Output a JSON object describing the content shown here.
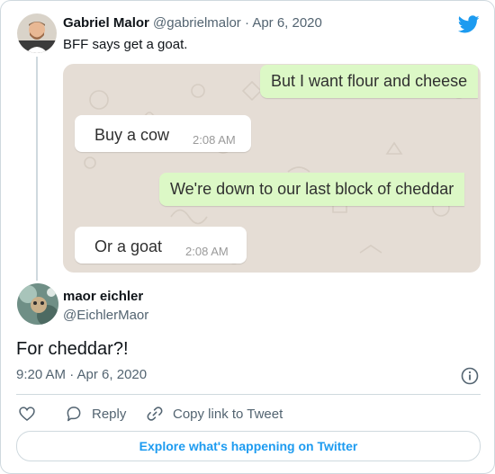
{
  "parent_tweet": {
    "author_name": "Gabriel Malor",
    "handle": "@gabrielmalor",
    "separator": "·",
    "date": "Apr 6, 2020",
    "text": "BFF says get a goat."
  },
  "chat_screenshot": {
    "messages": [
      {
        "text": "But I want flour and cheese",
        "direction": "outgoing"
      },
      {
        "text": "Buy a cow",
        "time": "2:08 AM",
        "direction": "incoming"
      },
      {
        "text": "We're down to our last block of cheddar",
        "direction": "outgoing"
      },
      {
        "text": "Or a goat",
        "time": "2:08 AM",
        "direction": "incoming"
      }
    ]
  },
  "reply_tweet": {
    "author_name": "maor eichler",
    "handle": "@EichlerMaor",
    "text": "For cheddar?!",
    "timestamp": "9:20 AM · Apr 6, 2020"
  },
  "actions": {
    "reply_label": "Reply",
    "copy_link_label": "Copy link to Tweet"
  },
  "footer": {
    "explore_label": "Explore what's happening on Twitter"
  },
  "icons": {
    "brand": "twitter-bird-icon",
    "info": "info-icon",
    "like": "heart-icon",
    "reply": "speech-bubble-icon",
    "copy_link": "link-icon"
  },
  "colors": {
    "twitter_blue": "#1d9bf0",
    "muted_text": "#536471",
    "chat_outgoing": "#dcf8c6",
    "chat_background": "#e5ddd5"
  }
}
